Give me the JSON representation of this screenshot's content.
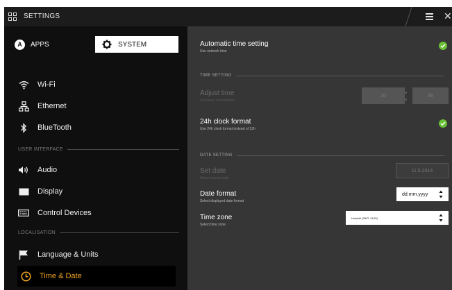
{
  "window": {
    "title": "SETTINGS"
  },
  "tabs": {
    "apps": "APPS",
    "system": "SYSTEM",
    "apps_badge": "A"
  },
  "sidebar": {
    "items": [
      {
        "label": "Wi-Fi",
        "icon": "wifi-icon"
      },
      {
        "label": "Ethernet",
        "icon": "ethernet-icon"
      },
      {
        "label": "BlueTooth",
        "icon": "bluetooth-icon"
      },
      {
        "label": "Audio",
        "icon": "speaker-icon"
      },
      {
        "label": "Display",
        "icon": "display-icon"
      },
      {
        "label": "Control Devices",
        "icon": "keyboard-icon"
      },
      {
        "label": "Language & Units",
        "icon": "flag-icon"
      },
      {
        "label": "Time & Date",
        "icon": "clock-icon",
        "selected": true
      }
    ],
    "sections": {
      "user_interface": "USER INTERFACE",
      "localisation": "LOCALISATION"
    }
  },
  "settings": {
    "automatic_time": {
      "title": "Automatic time setting",
      "subtitle": "Use network time",
      "checked": true
    },
    "time_section": "TIME SETTING",
    "adjust_time": {
      "title": "Adjust time",
      "subtitle": "Set hours and minutes",
      "hours": "10",
      "minutes": "56",
      "enabled": false
    },
    "clock_format": {
      "title": "24h clock format",
      "subtitle": "Use 24h clock format instead of 12h",
      "checked": true
    },
    "date_section": "DATE SETTING",
    "set_date": {
      "title": "Set date",
      "subtitle": "Select current date",
      "value": "11.5.2014",
      "enabled": false
    },
    "date_format": {
      "title": "Date format",
      "subtitle": "Select displayed date format",
      "value": "dd.mm.yyyy"
    },
    "time_zone": {
      "title": "Time zone",
      "subtitle": "Select time zone",
      "value": "Helsinki (GMT +3:00)"
    }
  },
  "colors": {
    "accent": "#f5a623",
    "check": "#69bf35",
    "panel_left": "#0f0f0f",
    "panel_right": "#363636",
    "titlebar": "#1c1c1c"
  }
}
